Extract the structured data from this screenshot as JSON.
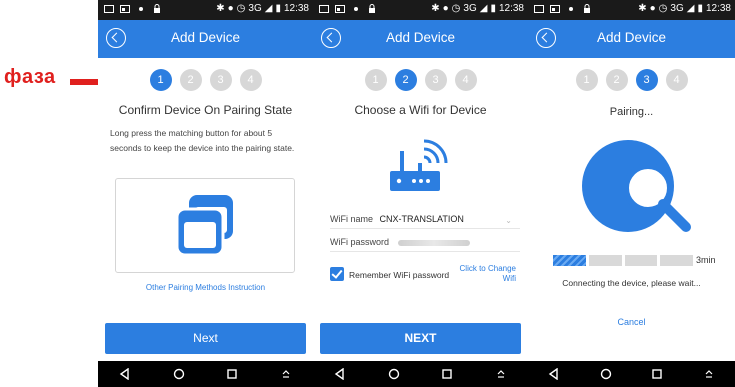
{
  "annotation": {
    "label": "фаза",
    "color": "#e0201e"
  },
  "statusbar": {
    "time": "12:38",
    "network": "3G"
  },
  "brand_color": "#2c7ee0",
  "screen1": {
    "title": "Add Device",
    "steps": [
      "1",
      "2",
      "3",
      "4"
    ],
    "active_step": 1,
    "heading": "Confirm Device On Pairing State",
    "instructions": "Long press the matching button for about 5 seconds to keep the device into the pairing state.",
    "link": "Other Pairing Methods Instruction",
    "button": "Next"
  },
  "screen2": {
    "title": "Add Device",
    "steps": [
      "1",
      "2",
      "3",
      "4"
    ],
    "active_step": 2,
    "heading": "Choose a Wifi for Device",
    "wifi_name_label": "WiFi name",
    "wifi_name_value": "CNX-TRANSLATION",
    "wifi_password_label": "WiFi password",
    "remember_label": "Remember WiFi password",
    "change_link": "Click to Change Wifi",
    "button": "NEXT"
  },
  "screen3": {
    "title": "Add Device",
    "steps": [
      "1",
      "2",
      "3",
      "4"
    ],
    "active_step": 3,
    "status": "Pairing...",
    "progress_fraction": 0.25,
    "time_left": "3min",
    "connecting": "Connecting the device, please wait...",
    "cancel": "Cancel"
  }
}
